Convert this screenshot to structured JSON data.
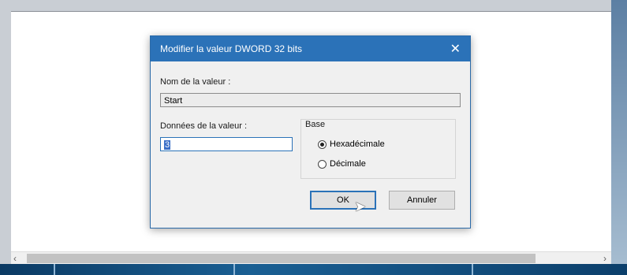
{
  "dialog": {
    "title": "Modifier la valeur DWORD 32 bits",
    "close_glyph": "✕",
    "value_name_label": "Nom de la valeur :",
    "value_name": "Start",
    "value_data_label": "Données de la valeur :",
    "value_data": "3",
    "base": {
      "group_label": "Base",
      "options": [
        {
          "label": "Hexadécimale",
          "selected": true
        },
        {
          "label": "Décimale",
          "selected": false
        }
      ]
    },
    "ok_label": "OK",
    "cancel_label": "Annuler"
  },
  "scrollbar": {
    "left_arrow": "‹",
    "right_arrow": "›"
  },
  "colors": {
    "titlebar": "#2b72b8",
    "dialog_bg": "#f0f0f0"
  }
}
